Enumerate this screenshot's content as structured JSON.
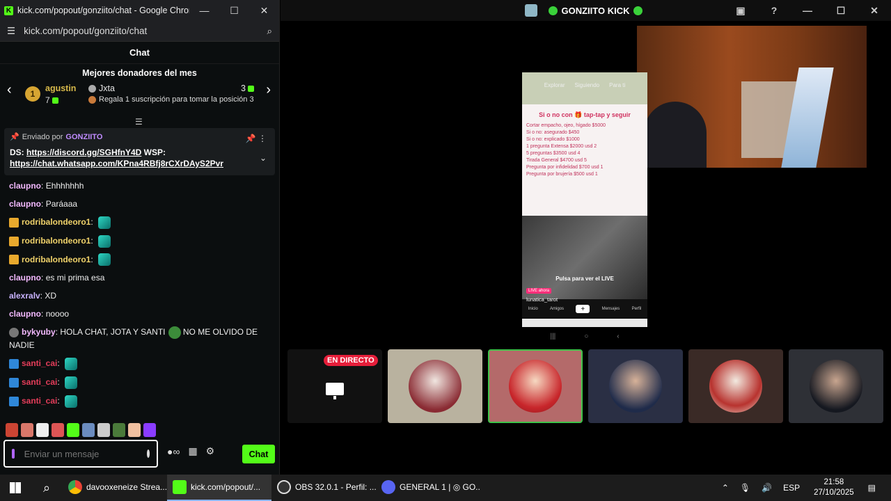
{
  "chrome": {
    "title": "kick.com/popout/gonziito/chat - Google Chrome",
    "url": "kick.com/popout/gonziito/chat"
  },
  "chat": {
    "header": "Chat",
    "donors_title": "Mejores donadores del mes",
    "top_donor": {
      "rank": "1",
      "name": "agustin",
      "count": "7"
    },
    "second": {
      "name": "Jxta",
      "count": "3",
      "cta": "Regala 1 suscripción para tomar la posición 3"
    },
    "pinned": {
      "sent_by_label": "Enviado por",
      "author": "GONZIITO",
      "line1_prefix": "DS: ",
      "link1": "https://discord.gg/SGHfnY4D",
      "line1_suffix": " WSP:",
      "link2": "https://chat.whatsapp.com/KPna4RBfj8rCXrDAyS2Pvr"
    },
    "messages": [
      {
        "user": "claupno",
        "text": "Ehhhhhhh",
        "style": "pink",
        "badge": "",
        "emote": false
      },
      {
        "user": "claupno",
        "text": "Paráaaa",
        "style": "pink",
        "badge": "",
        "emote": false
      },
      {
        "user": "rodribalondeoro1",
        "text": "",
        "style": "gold",
        "badge": "crown",
        "emote": true
      },
      {
        "user": "rodribalondeoro1",
        "text": "",
        "style": "gold",
        "badge": "crown",
        "emote": true
      },
      {
        "user": "rodribalondeoro1",
        "text": "",
        "style": "gold",
        "badge": "crown",
        "emote": true
      },
      {
        "user": "claupno",
        "text": "es mi prima esa",
        "style": "pink",
        "badge": "",
        "emote": false
      },
      {
        "user": "alexralv",
        "text": "XD",
        "style": "lilac",
        "badge": "",
        "emote": false
      },
      {
        "user": "claupno",
        "text": "noooo",
        "style": "pink",
        "badge": "",
        "emote": false
      },
      {
        "user": "bykyuby",
        "text": "HOLA CHAT, JOTA Y SANTI",
        "text2": "NO ME OLVIDO DE NADIE",
        "style": "pink",
        "badge": "grey",
        "emote": false,
        "pepe": true
      },
      {
        "user": "santi_cai",
        "text": "",
        "style": "red",
        "badge": "blue",
        "emote": true
      },
      {
        "user": "santi_cai",
        "text": "",
        "style": "red",
        "badge": "blue",
        "emote": true
      },
      {
        "user": "santi_cai",
        "text": "",
        "style": "red",
        "badge": "blue",
        "emote": true
      }
    ],
    "input_placeholder": "Enviar un mensaje",
    "send_label": "Chat"
  },
  "obs": {
    "title": "GONZIITO KICK",
    "phone": {
      "tabs": [
        "Explorar",
        "Siguiendo",
        "Para ti"
      ],
      "poster_title": "Si o no con 🎁 tap-tap y seguir",
      "poster_lines": [
        "Cortar empacho, ojeo, hígado $5000",
        "Si o no: asegurado $450",
        "Si o no: explicado $1000",
        "1 pregunta Extensa $2000 usd 2",
        "5 preguntas $3500 usd 4",
        "Tirada General $4700 usd 5",
        "Pregunta por infidelidad $700 usd 1",
        "Pregunta por brujería $500 usd 1"
      ],
      "live_tip": "Pulsa para ver el LIVE",
      "live_tag": "LIVE ahora",
      "username": "lunatica_tarot",
      "nav": [
        "Inicio",
        "Amigos",
        "+",
        "Mensajes",
        "Perfil"
      ]
    },
    "live_badge": "EN DIRECTO"
  },
  "taskbar": {
    "tasks": [
      {
        "label": "davooxeneize Strea...",
        "icon": "chrome",
        "active": false
      },
      {
        "label": "kick.com/popout/...",
        "icon": "kick",
        "active": true
      },
      {
        "label": "OBS 32.0.1 - Perfil: ...",
        "icon": "obs",
        "active": false
      },
      {
        "label": "GENERAL 1 | ◎ GO...",
        "icon": "discord",
        "active": false
      }
    ],
    "lang": "ESP",
    "time": "21:58",
    "date": "27/10/2025"
  }
}
